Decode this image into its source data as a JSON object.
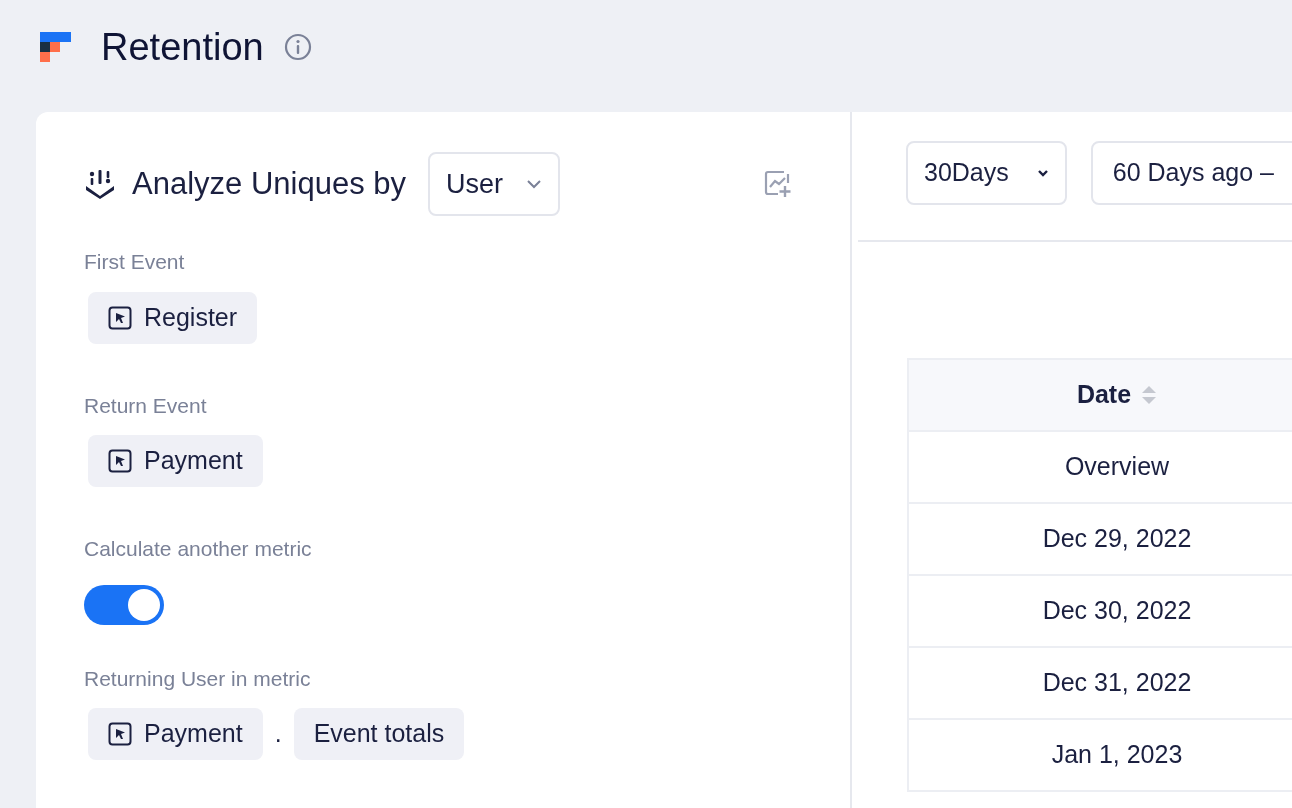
{
  "header": {
    "title": "Retention"
  },
  "analyze": {
    "label": "Analyze Uniques by",
    "dropdown": "User"
  },
  "first_event": {
    "label": "First Event",
    "event": "Register"
  },
  "return_event": {
    "label": "Return Event",
    "event": "Payment"
  },
  "another_metric": {
    "label": "Calculate another metric",
    "on": true
  },
  "returning_metric": {
    "label": "Returning User in metric",
    "event": "Payment",
    "separator": ".",
    "measure": "Event totals"
  },
  "filters": [
    {
      "label": "30Days",
      "caret": true
    },
    {
      "label": "60 Days ago –",
      "caret": false
    }
  ],
  "table": {
    "columns": [
      "Date"
    ],
    "rows": [
      [
        "Overview"
      ],
      [
        "Dec 29, 2022"
      ],
      [
        "Dec 30, 2022"
      ],
      [
        "Dec 31, 2022"
      ],
      [
        "Jan 1, 2023"
      ]
    ]
  }
}
